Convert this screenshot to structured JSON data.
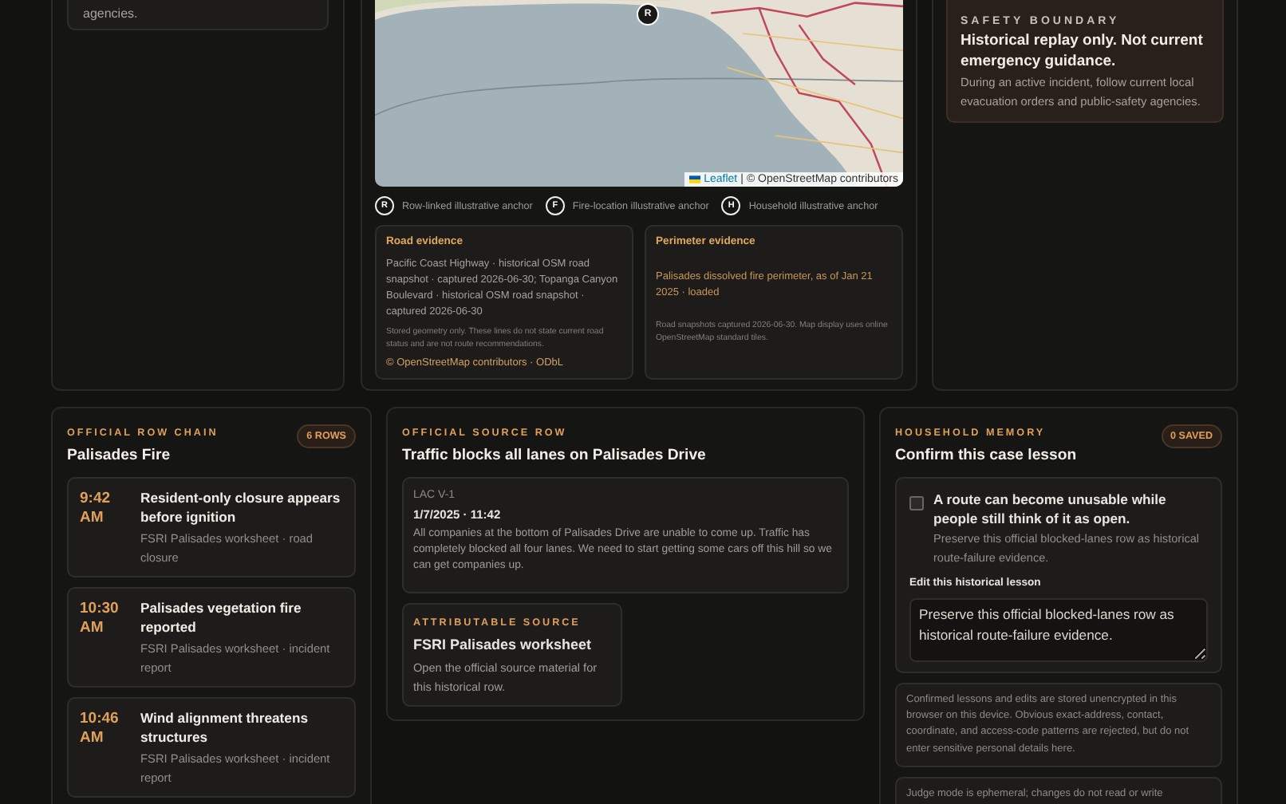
{
  "top_left_card": {
    "text": "agencies."
  },
  "map": {
    "marker": "R",
    "attribution_link": "Leaflet",
    "attribution_separator": "|",
    "attribution": "© OpenStreetMap contributors"
  },
  "legend": [
    {
      "glyph": "R",
      "label": "Row-linked illustrative anchor"
    },
    {
      "glyph": "F",
      "label": "Fire-location illustrative anchor"
    },
    {
      "glyph": "H",
      "label": "Household illustrative anchor"
    }
  ],
  "road_evidence": {
    "title": "Road evidence",
    "body": "Pacific Coast Highway · historical OSM road snapshot · captured 2026-06-30; Topanga Canyon Boulevard · historical OSM road snapshot · captured 2026-06-30",
    "note": "Stored geometry only. These lines do not state current road status and are not route recommendations.",
    "link": "© OpenStreetMap contributors · ODbL"
  },
  "perimeter_evidence": {
    "title": "Perimeter evidence",
    "status": "Palisades dissolved fire perimeter, as of Jan 21 2025 · loaded",
    "note": "Road snapshots captured 2026-06-30. Map display uses online OpenStreetMap standard tiles."
  },
  "safety_boundary": {
    "eyebrow": "SAFETY BOUNDARY",
    "title": "Historical replay only. Not current emergency guidance.",
    "body": "During an active incident, follow current local evacuation orders and public-safety agencies."
  },
  "row_chain": {
    "eyebrow": "OFFICIAL ROW CHAIN",
    "title": "Palisades Fire",
    "badge": "6 ROWS",
    "rows": [
      {
        "time": "9:42 AM",
        "title": "Resident-only closure appears before ignition",
        "source": "FSRI Palisades worksheet · road closure"
      },
      {
        "time": "10:30 AM",
        "title": "Palisades vegetation fire reported",
        "source": "FSRI Palisades worksheet · incident report"
      },
      {
        "time": "10:46 AM",
        "title": "Wind alignment threatens structures",
        "source": "FSRI Palisades worksheet · incident report"
      }
    ]
  },
  "source_row": {
    "eyebrow": "OFFICIAL SOURCE ROW",
    "title": "Traffic blocks all lanes on Palisades Drive",
    "record": {
      "id": "LAC V-1",
      "datetime": "1/7/2025 · 11:42",
      "text": "All companies at the bottom of Palisades Drive are unable to come up. Traffic has completely blocked all four lanes. We need to start getting some cars off this hill so we can get companies up."
    },
    "source_card": {
      "eyebrow": "ATTRIBUTABLE SOURCE",
      "title": "FSRI Palisades worksheet",
      "body": "Open the official source material for this historical row."
    }
  },
  "household": {
    "eyebrow": "HOUSEHOLD MEMORY",
    "title": "Confirm this case lesson",
    "badge": "0 SAVED",
    "lesson": {
      "checked": false,
      "title": "A route can become unusable while people still think of it as open.",
      "body": "Preserve this official blocked-lanes row as historical route-failure evidence."
    },
    "edit_label": "Edit this historical lesson",
    "edit_value": "Preserve this official blocked-lanes row as historical route-failure evidence.",
    "privacy_note": "Confirmed lessons and edits are stored unencrypted in this browser on this device. Obvious exact-address, contact, coordinate, and access-code patterns are rejected, but do not enter sensitive personal details here.",
    "judge_note": "Judge mode is ephemeral; changes do not read or write"
  }
}
